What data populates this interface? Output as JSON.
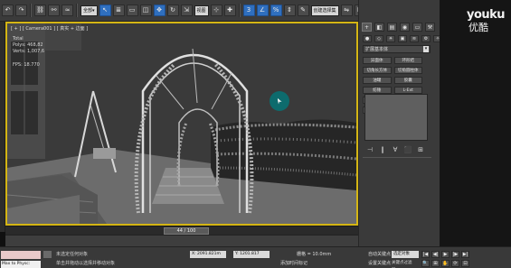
{
  "toolbar": {
    "icons": [
      "undo-icon",
      "redo-icon",
      "link-icon",
      "unlink-icon",
      "bind-icon",
      "select-icon",
      "select-by-name-icon",
      "rect-select-icon",
      "window-crossing-icon",
      "move-icon",
      "rotate-icon",
      "scale-icon"
    ],
    "view_dropdown": "视图",
    "named_selection_dropdown": "创建选择集"
  },
  "viewport": {
    "label": "[ + ] [ Camera001 ] [ 真实 + 边面 ]",
    "stats": {
      "total_label": "Total",
      "polys": "Polys: 468,82",
      "verts": "Verts: 1,007,6",
      "fps": "FPS:   18.770"
    },
    "border_color": "#d4b514"
  },
  "right_panel": {
    "tabs": [
      "+",
      "◧",
      "▤",
      "◉",
      "▭",
      "⚒"
    ],
    "sub_icons": [
      "●",
      "◇",
      "☀",
      "▣",
      "≋",
      "⚙",
      "✧"
    ],
    "dropdown": "扩展基本体",
    "buttons": [
      "异面体",
      "环形结",
      "切角长方体",
      "切角圆柱体",
      "油罐",
      "胶囊",
      "纺锤",
      "L-Ext",
      "球棱柱",
      "C-Ext",
      "环形波",
      "软管"
    ],
    "bottom_icons": [
      "⊣",
      "‖",
      "∀",
      "⬛",
      "⊞"
    ]
  },
  "timeline": {
    "frame_display": "44 / 100"
  },
  "statusbar": {
    "maxscript": "Max to Physc:",
    "line1": "未选定任何对象",
    "line2": "单击并拖动以选择并移动对象",
    "coord_x": "X: 2091.821m",
    "coord_y": "Y: 1201.817",
    "grid": "栅格 = 10.0mm",
    "add_time_tag": "添加时间标记",
    "autokey": "自动关键点",
    "setkey": "设置关键点",
    "selection_set": "选定对象",
    "key_filters": "关键点过滤器...",
    "play_controls": [
      "|◀",
      "◀|",
      "▶",
      "|▶",
      "▶|"
    ],
    "nav_controls": [
      "🔍",
      "⊞",
      "✋",
      "⟳",
      "⊡"
    ]
  },
  "watermark": {
    "youku_en": "youku",
    "youku_cn": "优酷"
  }
}
